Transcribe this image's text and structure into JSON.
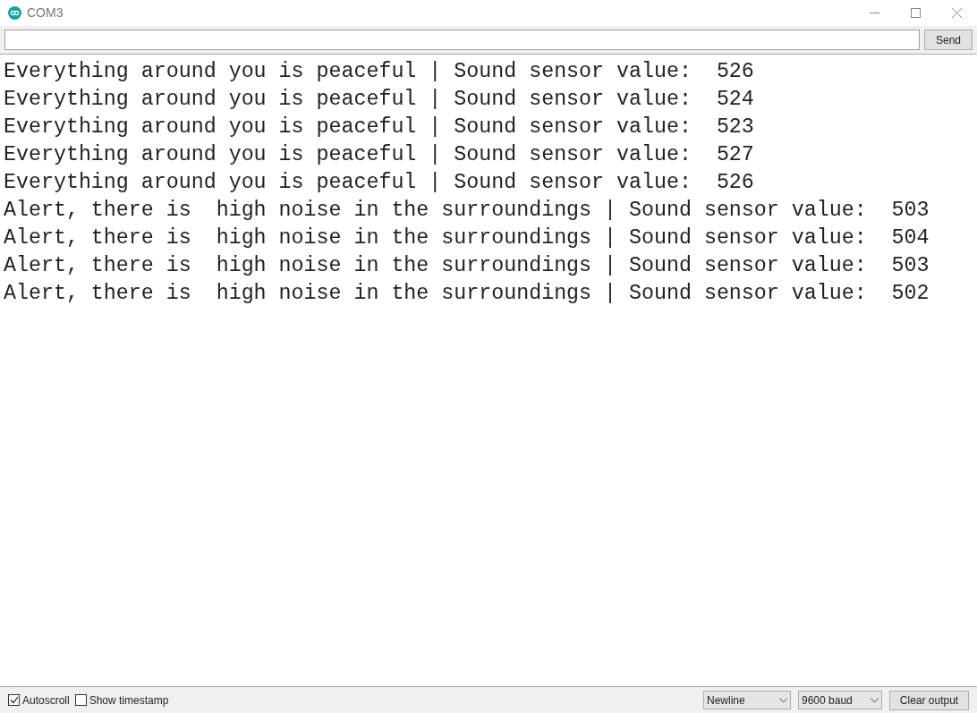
{
  "window": {
    "title": "COM3"
  },
  "send_button": "Send",
  "output_lines": [
    "Everything around you is peaceful | Sound sensor value:  526",
    "Everything around you is peaceful | Sound sensor value:  524",
    "Everything around you is peaceful | Sound sensor value:  523",
    "Everything around you is peaceful | Sound sensor value:  527",
    "Everything around you is peaceful | Sound sensor value:  526",
    "Alert, there is  high noise in the surroundings | Sound sensor value:  503",
    "Alert, there is  high noise in the surroundings | Sound sensor value:  504",
    "Alert, there is  high noise in the surroundings | Sound sensor value:  503",
    "Alert, there is  high noise in the surroundings | Sound sensor value:  502"
  ],
  "options": [
    {
      "label": "Autoscroll",
      "checked": true
    },
    {
      "label": "Show timestamp",
      "checked": false
    }
  ],
  "line_ending": "Newline",
  "baud_rate": "9600 baud",
  "clear_button": "Clear output"
}
